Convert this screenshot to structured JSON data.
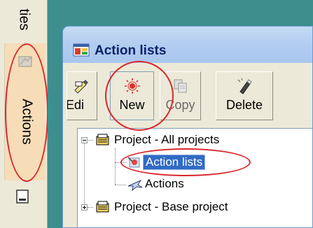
{
  "side_tabs": {
    "properties_label": "ties",
    "actions_label": "Actions"
  },
  "window": {
    "title": "Action lists"
  },
  "toolbar": {
    "edit_label": "Edi",
    "new_label": "New",
    "copy_label": "Copy",
    "delete_label": "Delete"
  },
  "tree": {
    "nodes": [
      {
        "label": "Project - All projects",
        "expanded": true
      },
      {
        "label": "Action lists",
        "selected": true
      },
      {
        "label": "Actions"
      },
      {
        "label": "Project - Base project",
        "expanded": false
      }
    ]
  },
  "colors": {
    "teal_background": "#3e8e8e",
    "title_text": "#0a246a",
    "selection": "#316ac5",
    "highlight_ellipse": "#d9262c",
    "actions_tab_bg": "#f6ddb8"
  }
}
